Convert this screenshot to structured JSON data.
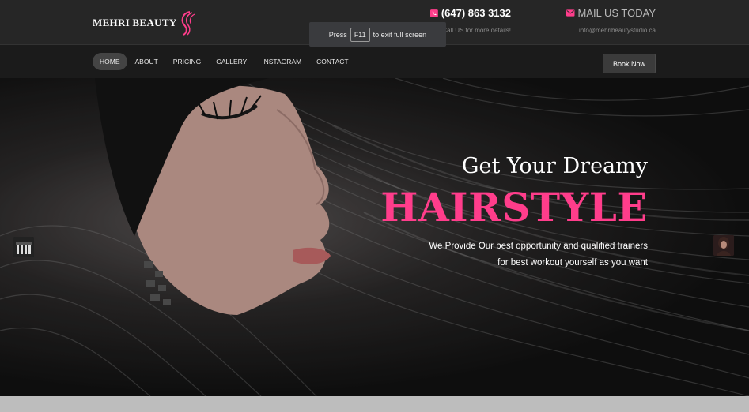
{
  "brand": {
    "name": "MEHRI BEAUTY",
    "accent": "#ff3d8b"
  },
  "contact": {
    "phone": {
      "icon": "phone-icon",
      "value": "(647) 863 3132",
      "sub": "Call US for more details!"
    },
    "mail": {
      "icon": "mail-icon",
      "value": "MAIL US TODAY",
      "sub": "info@mehribeautystudio.ca"
    }
  },
  "fullscreen_notice": {
    "before": "Press",
    "key": "F11",
    "after": "to exit full screen"
  },
  "nav": {
    "items": [
      "HOME",
      "ABOUT",
      "PRICING",
      "GALLERY",
      "INSTAGRAM",
      "CONTACT"
    ],
    "active": "HOME",
    "cta": "Book Now"
  },
  "hero": {
    "title": "Get Your Dreamy",
    "highlight": "HAIRSTYLE",
    "line1": "We Provide Our best opportunity and qualified trainers",
    "line2": "for best workout yourself as you want"
  }
}
